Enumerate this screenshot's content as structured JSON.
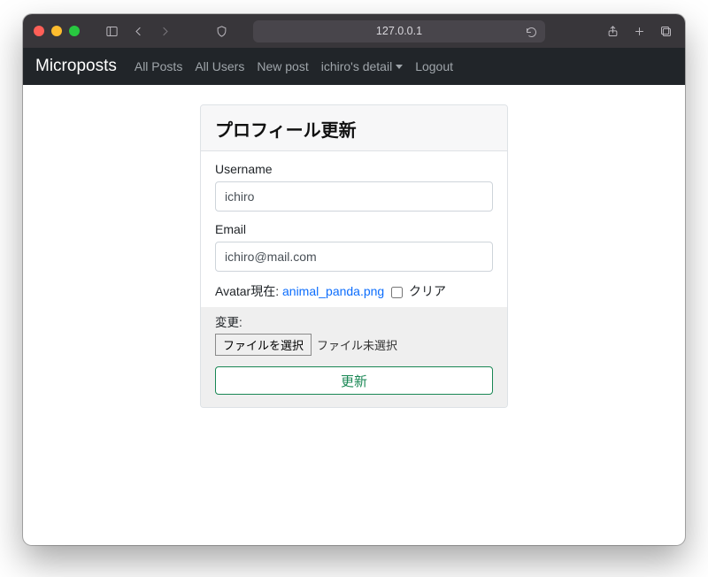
{
  "browser": {
    "address": "127.0.0.1"
  },
  "navbar": {
    "brand": "Microposts",
    "links": {
      "all_posts": "All Posts",
      "all_users": "All Users",
      "new_post": "New post",
      "user_detail": "ichiro's detail",
      "logout": "Logout"
    }
  },
  "card": {
    "title": "プロフィール更新",
    "username_label": "Username",
    "username_value": "ichiro",
    "email_label": "Email",
    "email_value": "ichiro@mail.com",
    "avatar_label_prefix": "Avatar",
    "avatar_current_label": "現在:",
    "avatar_filename": "animal_panda.png",
    "avatar_clear_label": "クリア",
    "avatar_change_label": "変更:",
    "file_button_label": "ファイルを選択",
    "file_none_label": "ファイル未選択",
    "submit_label": "更新"
  }
}
